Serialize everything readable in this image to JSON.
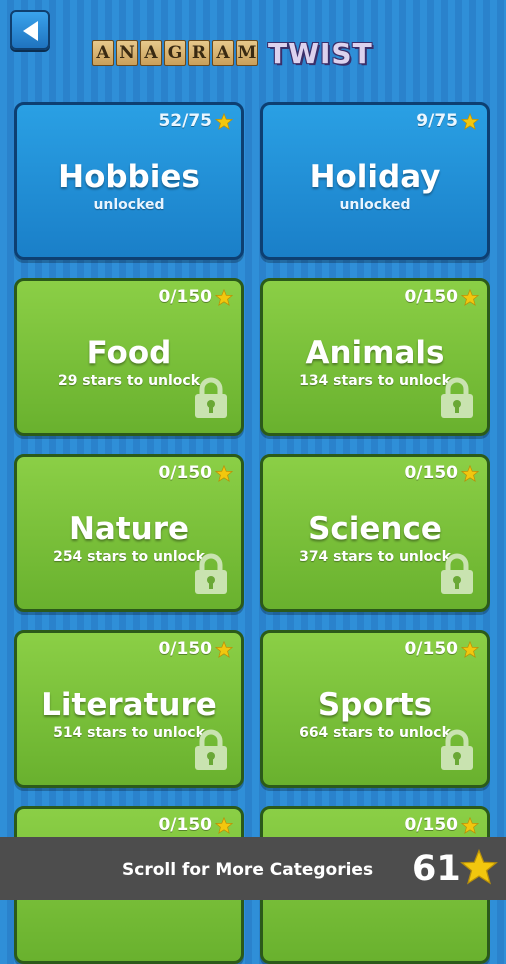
{
  "header": {
    "logo_letters": [
      "A",
      "N",
      "A",
      "G",
      "R",
      "A",
      "M"
    ],
    "logo_word2": "TWIST"
  },
  "categories": [
    {
      "name": "Hobbies",
      "progress": "52/75",
      "status": "unlocked",
      "state": "unlocked"
    },
    {
      "name": "Holiday",
      "progress": "9/75",
      "status": "unlocked",
      "state": "unlocked"
    },
    {
      "name": "Food",
      "progress": "0/150",
      "status": "29 stars to unlock",
      "state": "locked"
    },
    {
      "name": "Animals",
      "progress": "0/150",
      "status": "134 stars to unlock",
      "state": "locked"
    },
    {
      "name": "Nature",
      "progress": "0/150",
      "status": "254 stars to unlock",
      "state": "locked"
    },
    {
      "name": "Science",
      "progress": "0/150",
      "status": "374 stars to unlock",
      "state": "locked"
    },
    {
      "name": "Literature",
      "progress": "0/150",
      "status": "514 stars to unlock",
      "state": "locked"
    },
    {
      "name": "Sports",
      "progress": "0/150",
      "status": "664 stars to unlock",
      "state": "locked"
    },
    {
      "name": "",
      "progress": "0/150",
      "status": "",
      "state": "locked"
    },
    {
      "name": "",
      "progress": "0/150",
      "status": "",
      "state": "locked"
    }
  ],
  "footer": {
    "hint": "Scroll for More Categories",
    "total_stars": "61"
  },
  "colors": {
    "unlocked_card": "#1a7fc8",
    "locked_card": "#69b12e",
    "star": "#f2c70e",
    "footer_bg": "#4d4d4d"
  }
}
